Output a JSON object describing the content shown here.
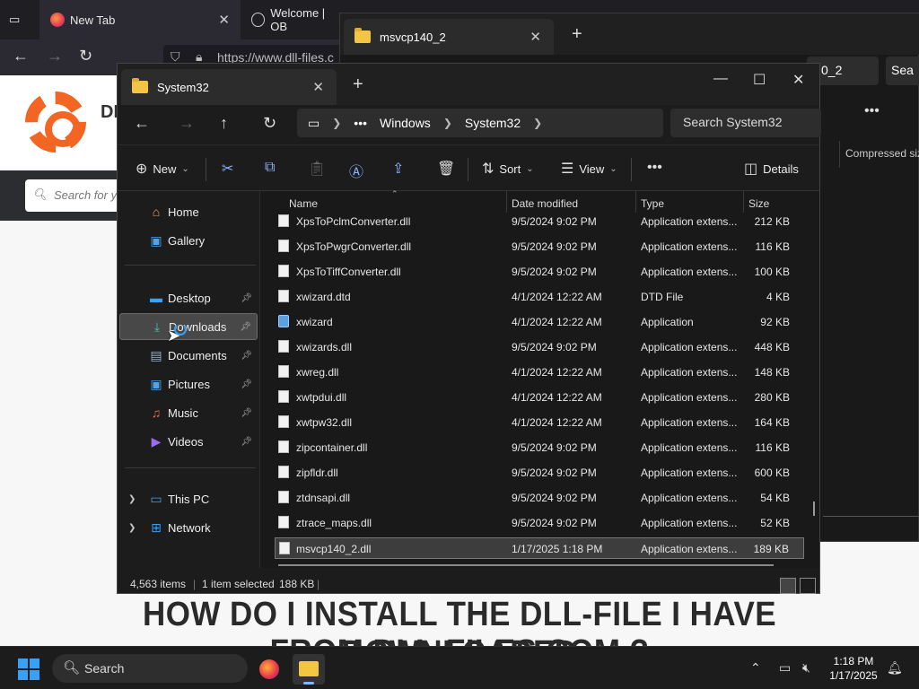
{
  "browser": {
    "tabs": [
      {
        "label": "New Tab"
      },
      {
        "label": "Welcome | OB"
      }
    ],
    "url": "https://www.dll-files.c",
    "site_search_placeholder": "Search for y",
    "site_logo_text": "DL",
    "headline_line1": "HOW DO I INSTALL THE DLL-FILE I HAVE DOWNLOADED",
    "headline_line2": "FROM DLL-FILES.COM ?"
  },
  "back_window": {
    "tab_title": "msvcp140_2",
    "address_text": "0_2",
    "search_text": "Sea",
    "column_label": "Compressed size"
  },
  "explorer": {
    "tab_title": "System32",
    "breadcrumbs": [
      "Windows",
      "System32"
    ],
    "search_placeholder": "Search System32",
    "commands": {
      "new": "New",
      "sort": "Sort",
      "view": "View",
      "details": "Details"
    },
    "nav": {
      "home": "Home",
      "gallery": "Gallery",
      "desktop": "Desktop",
      "downloads": "Downloads",
      "documents": "Documents",
      "pictures": "Pictures",
      "music": "Music",
      "videos": "Videos",
      "this_pc": "This PC",
      "network": "Network"
    },
    "columns": {
      "name": "Name",
      "date": "Date modified",
      "type": "Type",
      "size": "Size"
    },
    "files": [
      {
        "name": "XpsToPclmConverter.dll",
        "date": "9/5/2024 9:02 PM",
        "type": "Application extens...",
        "size": "212 KB"
      },
      {
        "name": "XpsToPwgrConverter.dll",
        "date": "9/5/2024 9:02 PM",
        "type": "Application extens...",
        "size": "116 KB"
      },
      {
        "name": "XpsToTiffConverter.dll",
        "date": "9/5/2024 9:02 PM",
        "type": "Application extens...",
        "size": "100 KB"
      },
      {
        "name": "xwizard.dtd",
        "date": "4/1/2024 12:22 AM",
        "type": "DTD File",
        "size": "4 KB"
      },
      {
        "name": "xwizard",
        "date": "4/1/2024 12:22 AM",
        "type": "Application",
        "size": "92 KB"
      },
      {
        "name": "xwizards.dll",
        "date": "9/5/2024 9:02 PM",
        "type": "Application extens...",
        "size": "448 KB"
      },
      {
        "name": "xwreg.dll",
        "date": "4/1/2024 12:22 AM",
        "type": "Application extens...",
        "size": "148 KB"
      },
      {
        "name": "xwtpdui.dll",
        "date": "4/1/2024 12:22 AM",
        "type": "Application extens...",
        "size": "280 KB"
      },
      {
        "name": "xwtpw32.dll",
        "date": "4/1/2024 12:22 AM",
        "type": "Application extens...",
        "size": "164 KB"
      },
      {
        "name": "zipcontainer.dll",
        "date": "9/5/2024 9:02 PM",
        "type": "Application extens...",
        "size": "116 KB"
      },
      {
        "name": "zipfldr.dll",
        "date": "9/5/2024 9:02 PM",
        "type": "Application extens...",
        "size": "600 KB"
      },
      {
        "name": "ztdnsapi.dll",
        "date": "9/5/2024 9:02 PM",
        "type": "Application extens...",
        "size": "54 KB"
      },
      {
        "name": "ztrace_maps.dll",
        "date": "9/5/2024 9:02 PM",
        "type": "Application extens...",
        "size": "52 KB"
      },
      {
        "name": "msvcp140_2.dll",
        "date": "1/17/2025 1:18 PM",
        "type": "Application extens...",
        "size": "189 KB"
      }
    ],
    "status": {
      "items": "4,563 items",
      "selected": "1 item selected",
      "selected_size": "188 KB"
    }
  },
  "taskbar": {
    "search_label": "Search",
    "time": "1:18 PM",
    "date": "1/17/2025"
  }
}
